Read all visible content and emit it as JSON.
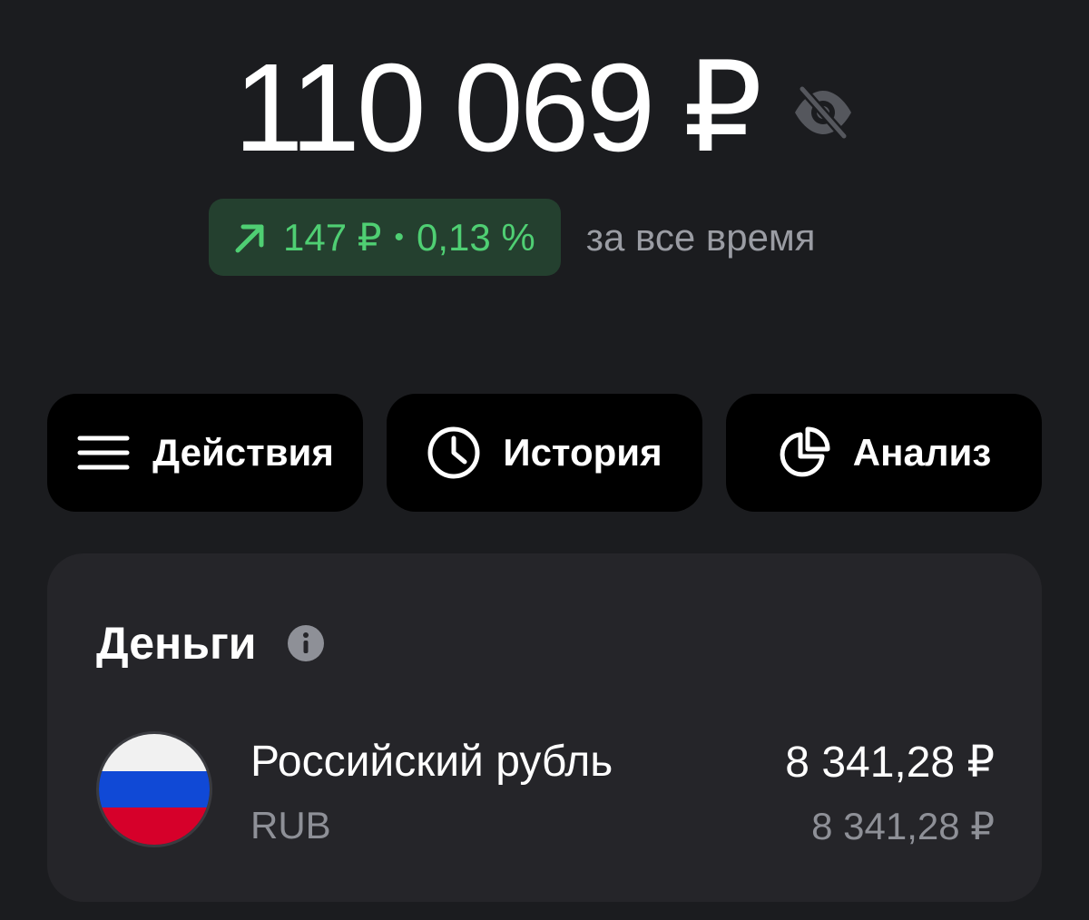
{
  "balance": {
    "value": "110 069 ₽",
    "visibility_icon": "eye-off-icon"
  },
  "change": {
    "arrow_icon": "arrow-up-right-icon",
    "amount": "147 ₽",
    "separator": "•",
    "percent": "0,13 %",
    "period": "за все время",
    "color": "#4fcf73"
  },
  "actions": [
    {
      "icon": "menu-icon",
      "label": "Действия"
    },
    {
      "icon": "clock-icon",
      "label": "История"
    },
    {
      "icon": "pie-chart-icon",
      "label": "Анализ"
    }
  ],
  "money": {
    "title": "Деньги",
    "info_icon": "info-icon",
    "items": [
      {
        "flag_icon": "russia-flag-icon",
        "name": "Российский рубль",
        "code": "RUB",
        "amount": "8 341,28 ₽",
        "amount_secondary": "8 341,28 ₽"
      }
    ]
  },
  "colors": {
    "background": "#1b1c1f",
    "card": "#252529",
    "button": "#000000",
    "positive": "#4fcf73",
    "positive_bg": "#24402f",
    "muted": "#8e9097"
  }
}
